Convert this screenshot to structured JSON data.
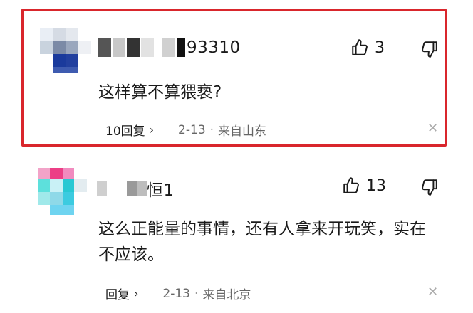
{
  "comments": [
    {
      "username": "93310",
      "likes": "3",
      "text": "这样算不算猥亵?",
      "reply_label": "10回复",
      "date": "2-13",
      "location": "来自山东"
    },
    {
      "username": "恒1",
      "likes": "13",
      "text": "这么正能量的事情，还有人拿来开玩笑，实在不应该。",
      "reply_label": "回复",
      "date": "2-13",
      "location": "来自北京"
    }
  ],
  "icons": {
    "like": "thumbs-up-icon",
    "dislike": "thumbs-down-icon",
    "chevron": "chevron-right-icon",
    "close": "close-icon"
  },
  "colors": {
    "highlight_border": "#d9262c",
    "text": "#1a1a1a",
    "meta": "#666666"
  }
}
